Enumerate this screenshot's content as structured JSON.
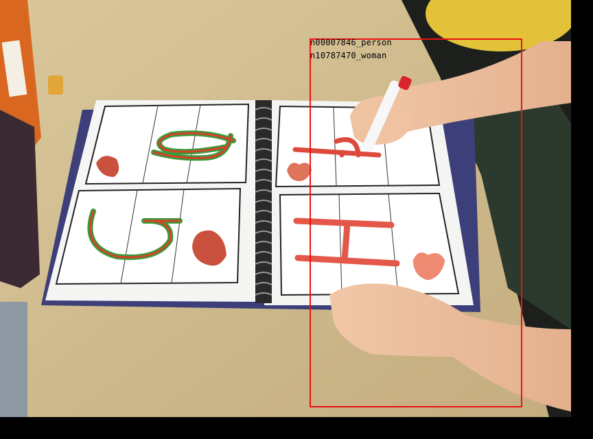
{
  "photo": {
    "description_icon": "photo-child-tracing-letters-in-binder",
    "pages": {
      "left_top_letter": "g",
      "left_bottom_letter": "G",
      "right_top_letter": "h",
      "right_bottom_letter": "H"
    }
  },
  "annotation": {
    "box_color": "#ee1111",
    "labels": [
      "n00007846_person",
      "n10787470_woman"
    ]
  }
}
